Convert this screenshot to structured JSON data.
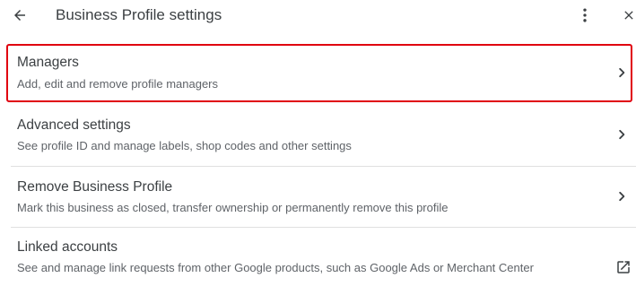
{
  "header": {
    "title": "Business Profile settings",
    "back_icon": "arrow-back-icon",
    "more_icon": "more-vert-icon",
    "close_icon": "close-icon"
  },
  "items": [
    {
      "title": "Managers",
      "description": "Add, edit and remove profile managers",
      "trailing_icon": "chevron-right-icon",
      "highlighted": true
    },
    {
      "title": "Advanced settings",
      "description": "See profile ID and manage labels, shop codes and other settings",
      "trailing_icon": "chevron-right-icon"
    },
    {
      "title": "Remove Business Profile",
      "description": "Mark this business as closed, transfer ownership or permanently remove this profile",
      "trailing_icon": "chevron-right-icon"
    },
    {
      "title": "Linked accounts",
      "description": "See and manage link requests from other Google products, such as Google Ads or Merchant Center",
      "trailing_icon": "open-in-new-icon"
    }
  ],
  "colors": {
    "highlight_border": "#e0000f",
    "divider": "#e0e0e0",
    "text_primary": "#3c4043",
    "text_secondary": "#5f6368"
  }
}
